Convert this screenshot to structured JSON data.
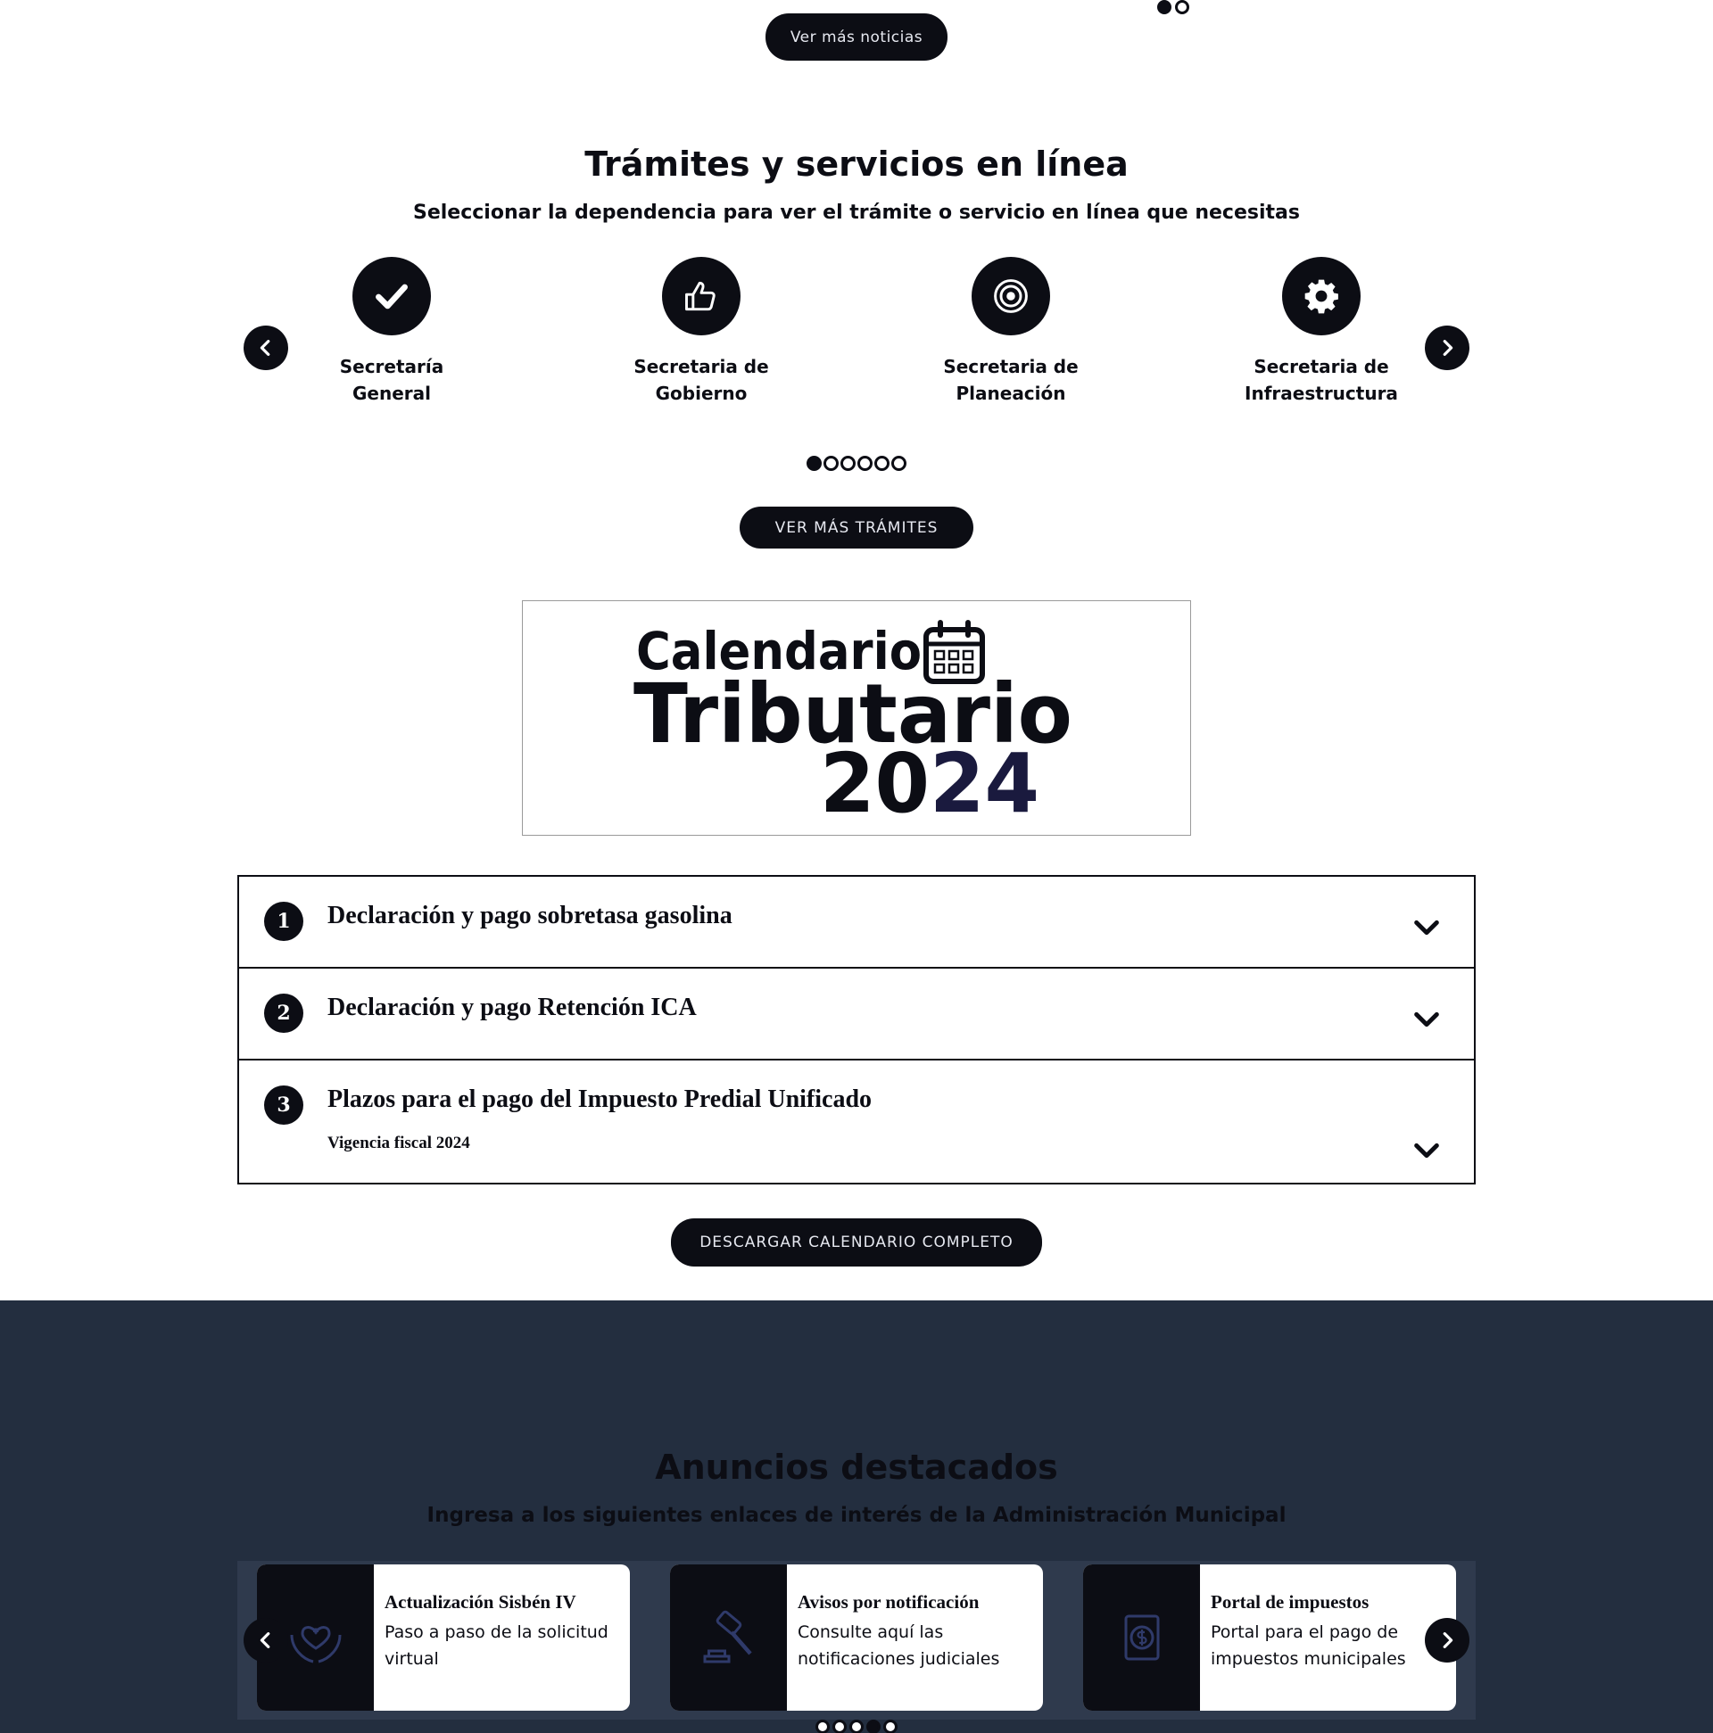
{
  "news": {
    "button_label": "Ver más noticias"
  },
  "tramites": {
    "title": "Trámites y servicios en línea",
    "subtitle": "Seleccionar la dependencia para ver el trámite o servicio en línea que necesitas",
    "departments": [
      {
        "label_line1": "Secretaría",
        "label_line2": "General",
        "icon": "check-icon"
      },
      {
        "label_line1": "Secretaria de",
        "label_line2": "Gobierno",
        "icon": "thumbs-up-icon"
      },
      {
        "label_line1": "Secretaria de",
        "label_line2": "Planeación",
        "icon": "target-icon"
      },
      {
        "label_line1": "Secretaria de",
        "label_line2": "Infraestructura",
        "icon": "gear-icon"
      }
    ],
    "pagination_total": 6,
    "pagination_active": 1,
    "button_label": "VER MÁS TRÁMITES"
  },
  "banner": {
    "line1": "Calendario",
    "line2": "Tributario",
    "year_a": "20",
    "year_b": "24",
    "icon": "calendar-icon",
    "colors": {
      "ink": "#0c0d14",
      "accent": "#1a1a3e"
    }
  },
  "accordion": [
    {
      "number": "1",
      "title": "Declaración y pago sobretasa gasolina",
      "subtitle": ""
    },
    {
      "number": "2",
      "title": "Declaración y pago Retención ICA",
      "subtitle": ""
    },
    {
      "number": "3",
      "title": "Plazos para el pago del Impuesto Predial Unificado",
      "subtitle": "Vigencia fiscal 2024"
    }
  ],
  "calendar_button": "DESCARGAR CALENDARIO COMPLETO",
  "anuncios": {
    "title": "Anuncios destacados",
    "subtitle": "Ingresa a los siguientes enlaces de interés de la Administración Municipal",
    "cards": [
      {
        "title": "Actualización Sisbén IV",
        "desc": "Paso a paso de la solicitud virtual",
        "icon": "heart-hands-icon"
      },
      {
        "title": "Avisos por notificación",
        "desc": "Consulte aquí las notificaciones judiciales",
        "icon": "gavel-icon"
      },
      {
        "title": "Portal de impuestos",
        "desc": "Portal para el pago de impuestos municipales",
        "icon": "dollar-document-icon"
      }
    ],
    "pagination_total": 5,
    "pagination_active": 4
  },
  "colors": {
    "dark": "#0c0d14",
    "section_bg": "#232e3f",
    "button_text": "#e6e8f0"
  }
}
